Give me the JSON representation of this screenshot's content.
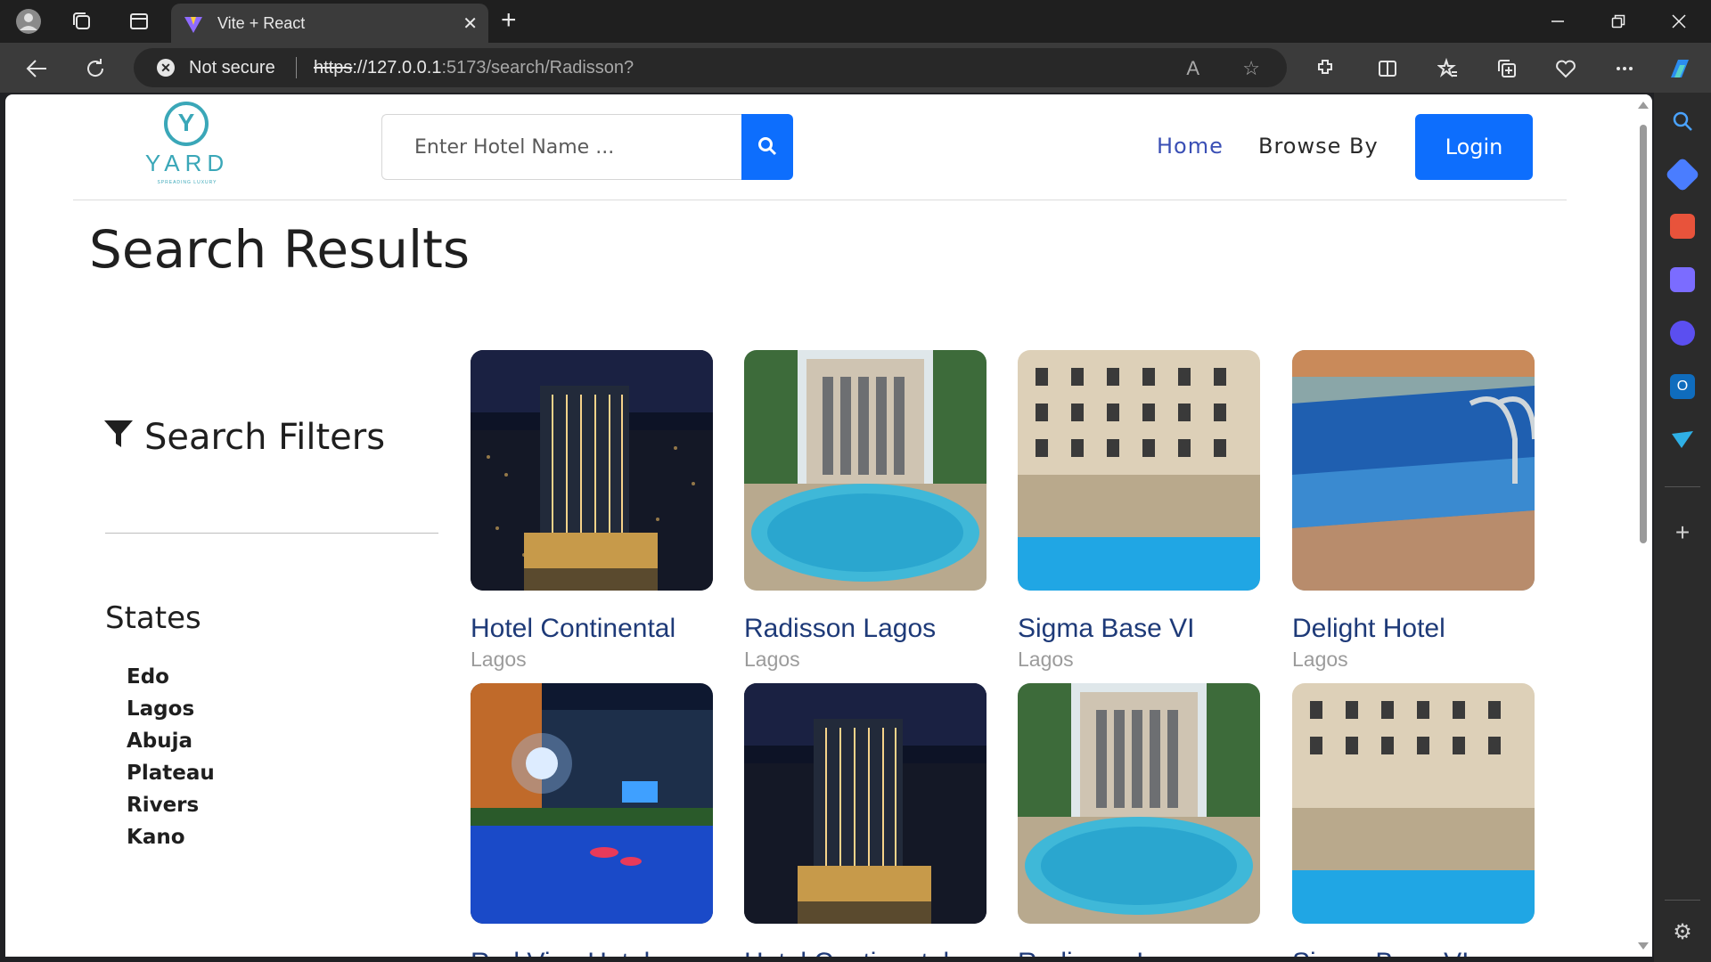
{
  "browser": {
    "tab_title": "Vite + React",
    "security_label": "Not secure",
    "url_scheme": "https",
    "url_host": "://127.0.0.1",
    "url_rest": ":5173/search/Radisson?"
  },
  "navbar": {
    "logo_text": "YARD",
    "logo_letter": "Y",
    "logo_tagline": "SPREADING LUXURY",
    "search_placeholder": "Enter Hotel Name ...",
    "links": [
      "Home",
      "Browse By"
    ],
    "login_label": "Login"
  },
  "page": {
    "title": "Search Results"
  },
  "filters": {
    "title": "Search Filters",
    "states_title": "States",
    "states": [
      "Edo",
      "Lagos",
      "Abuja",
      "Plateau",
      "Rivers",
      "Kano"
    ]
  },
  "hotels_row1": [
    {
      "name": "Hotel Continental",
      "location": "Lagos",
      "image": "night-tower"
    },
    {
      "name": "Radisson Lagos",
      "location": "Lagos",
      "image": "pool-facade"
    },
    {
      "name": "Sigma Base VI",
      "location": "Lagos",
      "image": "building-pool"
    },
    {
      "name": "Delight Hotel",
      "location": "Lagos",
      "image": "pool-closeup"
    }
  ],
  "hotels_row2_images": [
    "night-pool",
    "night-tower",
    "pool-facade",
    "building-pool"
  ],
  "hotels_row2_partial_names": [
    "Red Vine Hotel",
    "Hotel Continental",
    "Radisson Lagos",
    "Sigma Base VI"
  ],
  "colors": {
    "brand": "#3aa7b8",
    "primary": "#0d6efd",
    "hotel_name": "#1e3a78"
  }
}
